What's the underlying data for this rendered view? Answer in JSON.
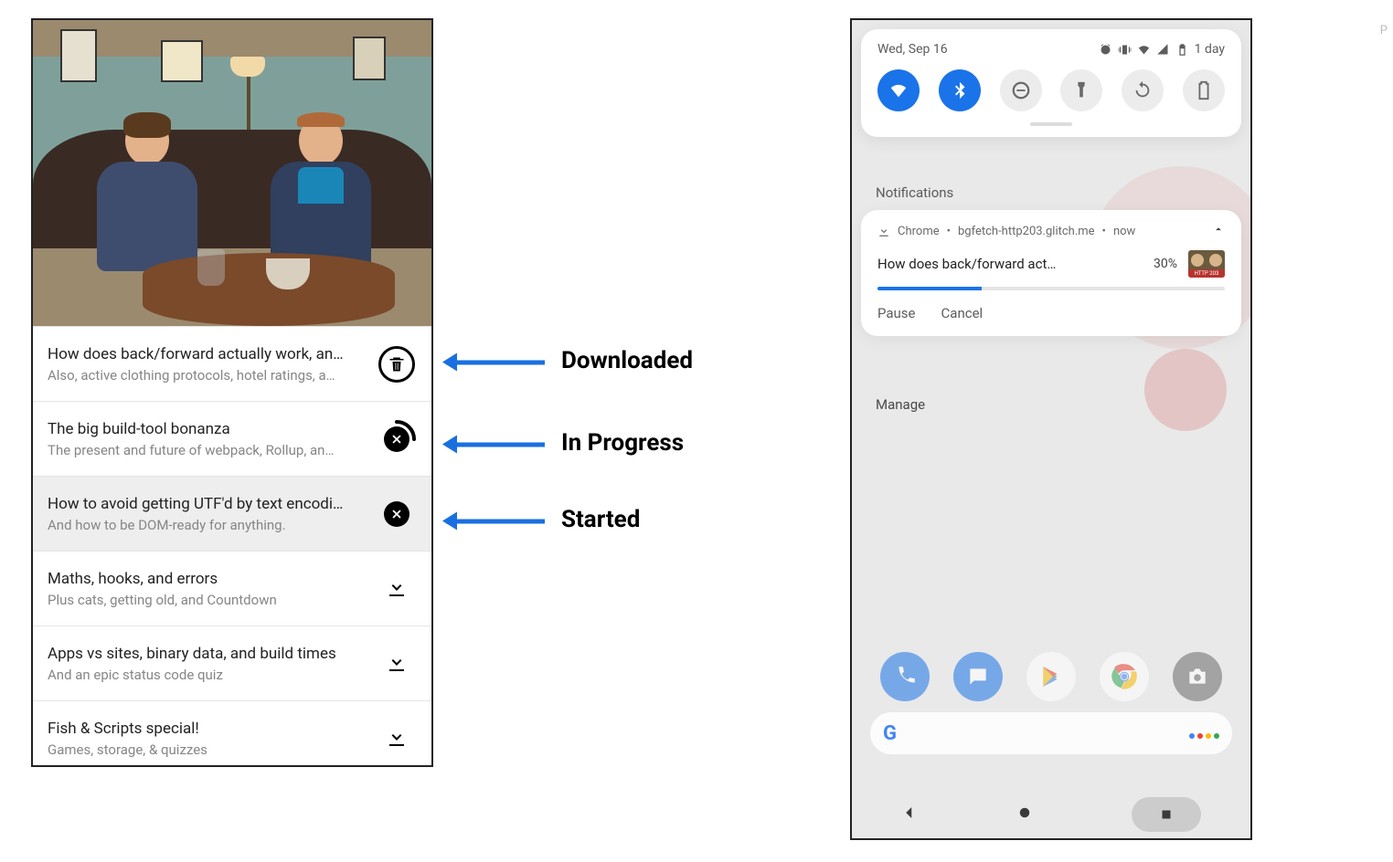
{
  "page_marker": "P",
  "annotations": {
    "downloaded": "Downloaded",
    "in_progress": "In Progress",
    "started": "Started"
  },
  "left": {
    "episodes": [
      {
        "title": "How does back/forward actually work, an…",
        "subtitle": "Also, active clothing protocols, hotel ratings, a…",
        "state": "downloaded"
      },
      {
        "title": "The big build-tool bonanza",
        "subtitle": "The present and future of webpack, Rollup, an…",
        "state": "in_progress"
      },
      {
        "title": "How to avoid getting UTF'd by text encodi…",
        "subtitle": "And how to be DOM-ready for anything.",
        "state": "started"
      },
      {
        "title": "Maths, hooks, and errors",
        "subtitle": "Plus cats, getting old, and Countdown",
        "state": "idle"
      },
      {
        "title": "Apps vs sites, binary data, and build times",
        "subtitle": "And an epic status code quiz",
        "state": "idle"
      },
      {
        "title": "Fish & Scripts special!",
        "subtitle": "Games, storage, & quizzes",
        "state": "idle"
      }
    ]
  },
  "right": {
    "status_date": "Wed, Sep 16",
    "status_battery_text": "1 day",
    "quick_settings": [
      {
        "name": "wifi",
        "on": true
      },
      {
        "name": "bluetooth",
        "on": true
      },
      {
        "name": "dnd",
        "on": false
      },
      {
        "name": "flashlight",
        "on": false
      },
      {
        "name": "rotate",
        "on": false
      },
      {
        "name": "battery-saver",
        "on": false
      }
    ],
    "section_label": "Notifications",
    "notification": {
      "app": "Chrome",
      "source": "bgfetch-http203.glitch.me",
      "time": "now",
      "title": "How does back/forward act…",
      "percent_text": "30%",
      "percent": 30,
      "thumb_tag": "HTTP 203",
      "actions": {
        "pause": "Pause",
        "cancel": "Cancel"
      }
    },
    "manage": "Manage"
  }
}
